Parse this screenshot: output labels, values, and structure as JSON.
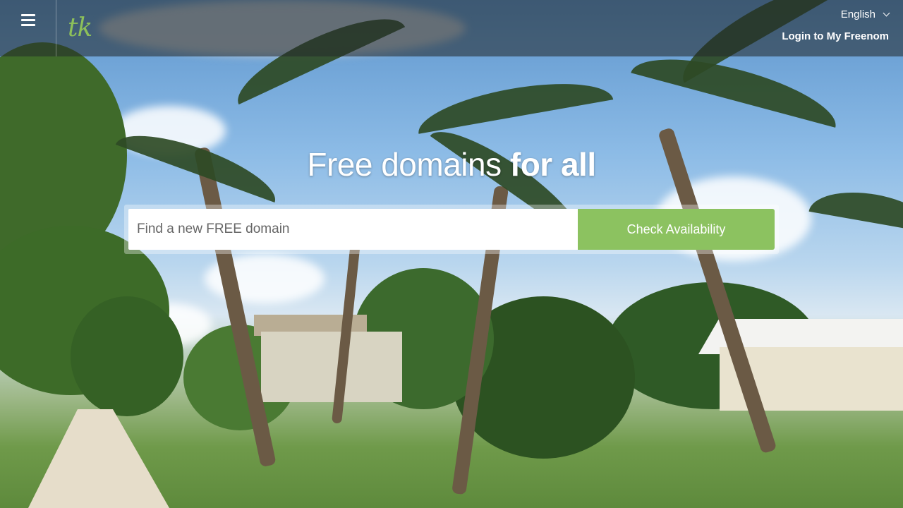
{
  "header": {
    "menu_icon": "hamburger-menu-icon",
    "logo_text": "tk",
    "language": "English",
    "login_label": "Login to My Freenom"
  },
  "hero": {
    "title_light": "Free domains ",
    "title_bold": "for all"
  },
  "search": {
    "placeholder": "Find a new FREE domain",
    "value": "",
    "button_label": "Check Availability"
  },
  "colors": {
    "accent_green": "#8cc260",
    "header_overlay": "rgba(35,40,42,0.55)"
  }
}
